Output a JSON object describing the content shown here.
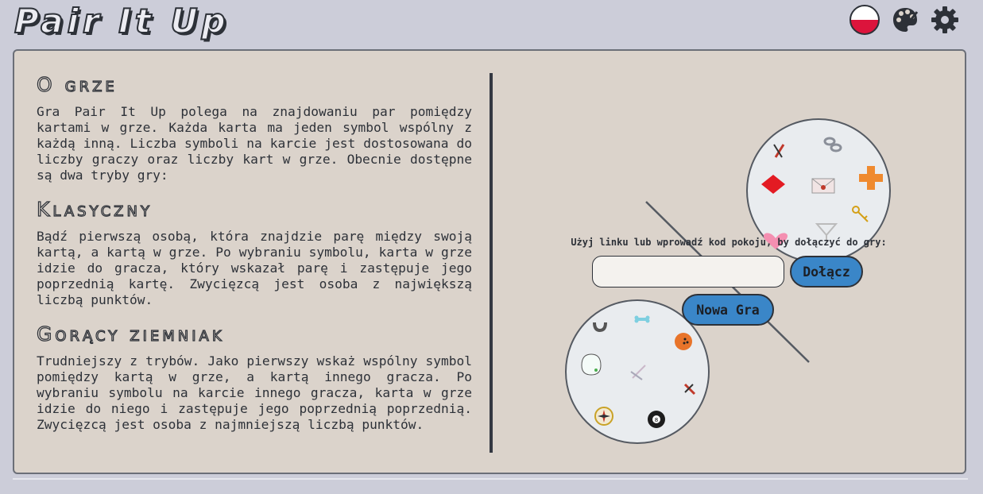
{
  "app": {
    "logo": "Pair It Up"
  },
  "header": {
    "icons": [
      "polish-flag-icon",
      "palette-icon",
      "gear-icon"
    ]
  },
  "colors": {
    "background": "#cccdd9",
    "panel": "#dbd3cb",
    "button": "#3a86c8",
    "text": "#2d3138"
  },
  "about": {
    "title": "O grze",
    "intro": "Gra Pair It Up polega na znajdowaniu par pomiędzy kartami w grze. Każda karta ma jeden symbol wspólny z każdą inną. Liczba symboli na karcie jest dostosowana do liczby graczy oraz liczby kart w grze. Obecnie dostępne są dwa tryby gry:",
    "modes": [
      {
        "title": "Klasyczny",
        "text": "Bądź pierwszą osobą, która znajdzie parę między swoją kartą, a kartą w grze. Po wybraniu symbolu, karta w grze idzie do gracza, który wskazał parę i zastępuje jego poprzednią kartę. Zwycięzcą jest osoba z największą liczbą punktów."
      },
      {
        "title": "Gorący ziemniak",
        "text": "Trudniejszy z trybów. Jako pierwszy wskaż wspólny symbol pomiędzy kartą w grze, a kartą innego gracza. Po wybraniu symbolu na karcie innego gracza, karta w grze idzie do niego i zastępuje jego poprzednią poprzednią. Zwycięzcą jest osoba z najmniejszą liczbą punktów."
      }
    ]
  },
  "join": {
    "label": "Użyj linku lub wprowadź kod pokoju, by dołączyć do gry:",
    "input_placeholder": "",
    "join_button": "Dołącz",
    "new_game_button": "Nowa Gra"
  },
  "cards": [
    {
      "name": "top-card",
      "symbols": [
        "scissors-icon",
        "chain-icon",
        "diamond-icon",
        "envelope-icon",
        "cross-icon",
        "heart-icon",
        "cocktail-glass-icon",
        "key-icon"
      ]
    },
    {
      "name": "bottom-card",
      "symbols": [
        "magnet-icon",
        "bone-icon",
        "bowling-ball-icon",
        "bag-icon",
        "toothbrush-icon",
        "scissors-icon",
        "compass-icon",
        "eight-ball-icon"
      ]
    }
  ]
}
